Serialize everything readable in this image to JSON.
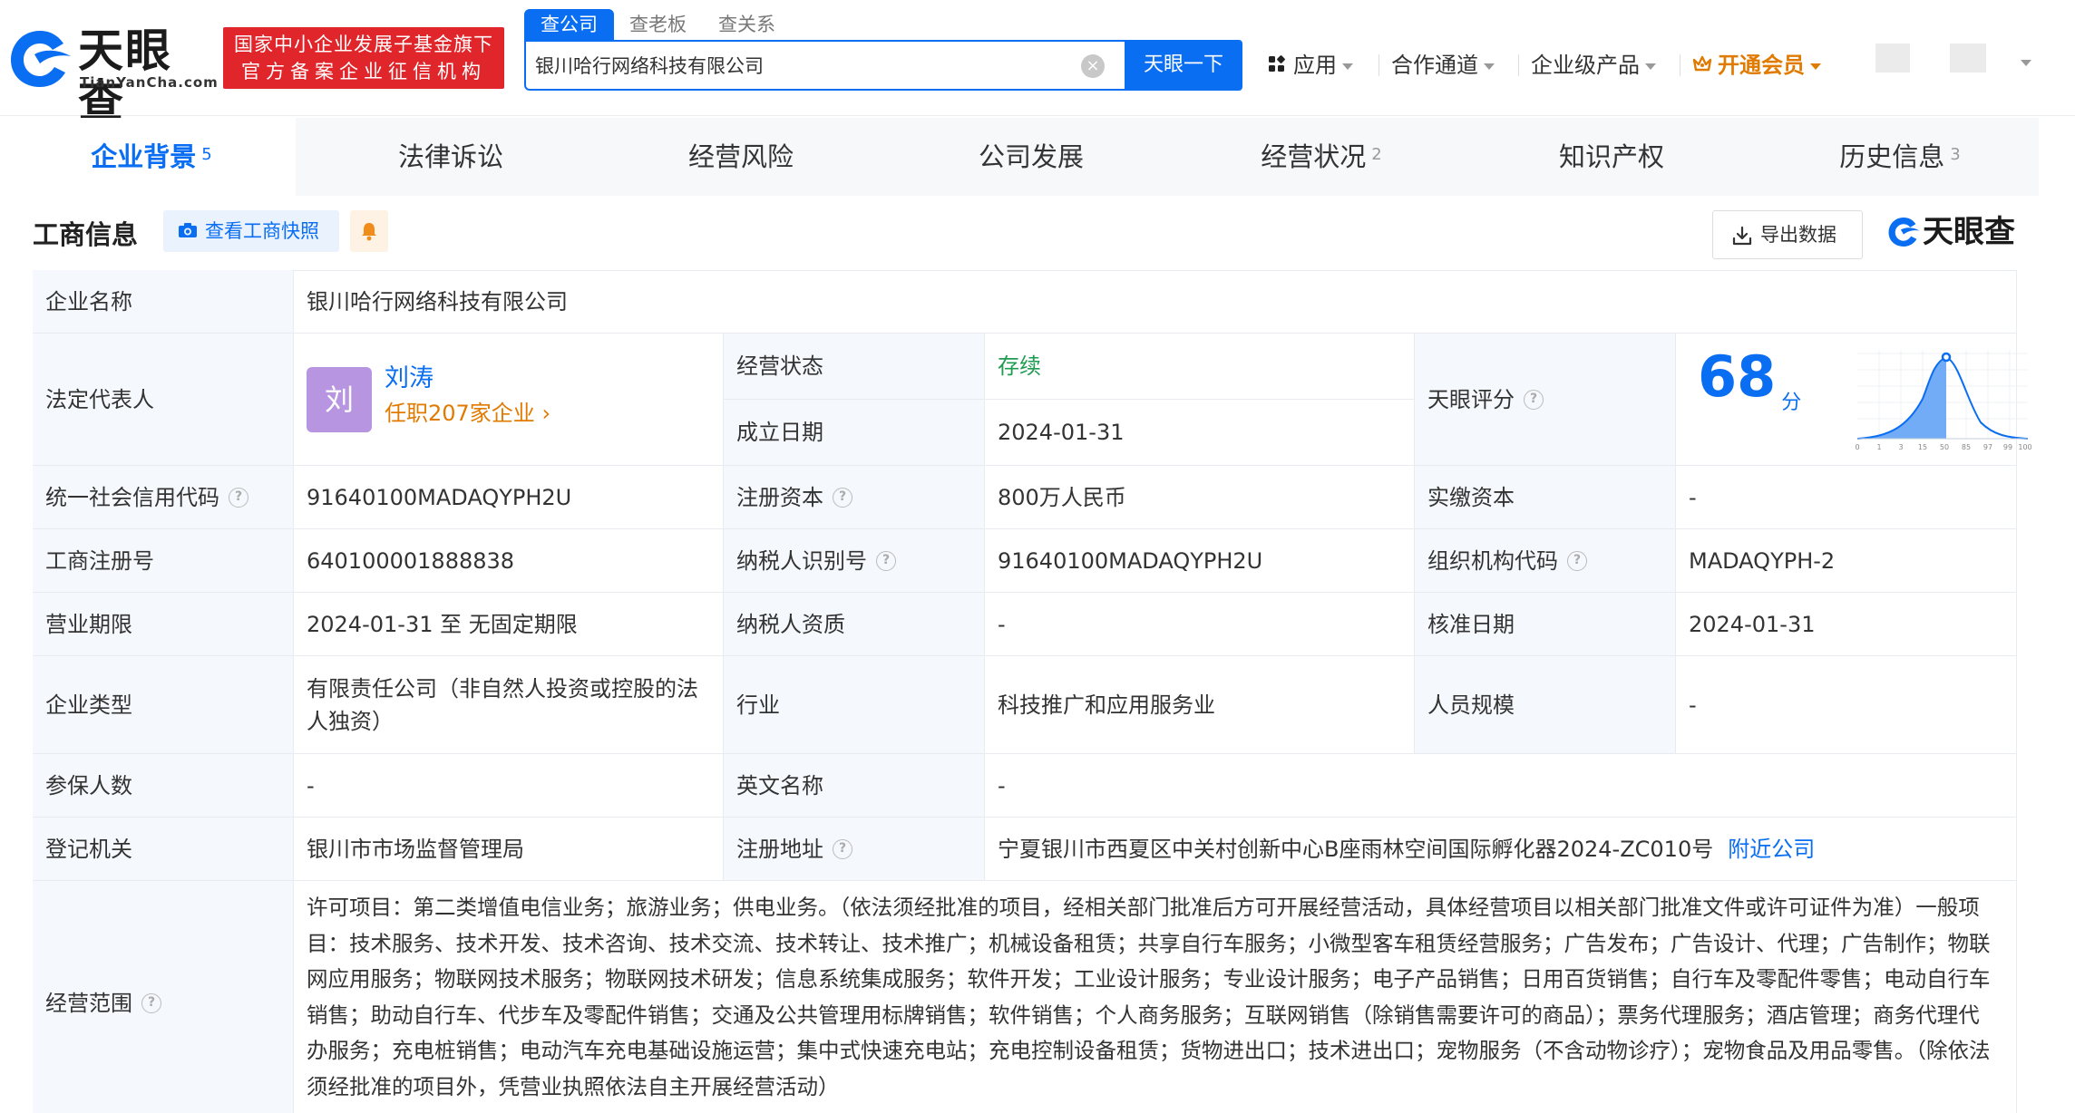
{
  "header": {
    "logo_text": "天眼查",
    "logo_sub": "TianYanCha.com",
    "gov_badge_line1": "国家中小企业发展子基金旗下",
    "gov_badge_line2": "官方备案企业征信机构",
    "search_tabs": [
      "查公司",
      "查老板",
      "查关系"
    ],
    "search_value": "银川哈行网络科技有限公司",
    "search_button": "天眼一下",
    "nav": {
      "apps": "应用",
      "partner": "合作通道",
      "enterprise": "企业级产品",
      "vip": "开通会员"
    }
  },
  "tabs": [
    {
      "label": "企业背景",
      "count": "5"
    },
    {
      "label": "法律诉讼",
      "count": ""
    },
    {
      "label": "经营风险",
      "count": ""
    },
    {
      "label": "公司发展",
      "count": ""
    },
    {
      "label": "经营状况",
      "count": "2"
    },
    {
      "label": "知识产权",
      "count": ""
    },
    {
      "label": "历史信息",
      "count": "3"
    }
  ],
  "section": {
    "title": "工商信息",
    "snapshot_button": "查看工商快照",
    "export_button": "导出数据",
    "brand": "天眼查"
  },
  "info": {
    "company_name_label": "企业名称",
    "company_name": "银川哈行网络科技有限公司",
    "legal_rep_label": "法定代表人",
    "legal_rep_avatar": "刘",
    "legal_rep_name": "刘涛",
    "legal_rep_positions": "任职207家企业",
    "status_label": "经营状态",
    "status": "存续",
    "founded_label": "成立日期",
    "founded": "2024-01-31",
    "score_label": "天眼评分",
    "score": "68",
    "score_unit": "分",
    "score_axis": [
      "0",
      "1",
      "3",
      "15",
      "50",
      "85",
      "97",
      "99",
      "100"
    ],
    "credit_code_label": "统一社会信用代码",
    "credit_code": "91640100MADAQYPH2U",
    "reg_capital_label": "注册资本",
    "reg_capital": "800万人民币",
    "paid_capital_label": "实缴资本",
    "paid_capital": "-",
    "reg_no_label": "工商注册号",
    "reg_no": "640100001888838",
    "taxpayer_id_label": "纳税人识别号",
    "taxpayer_id": "91640100MADAQYPH2U",
    "org_code_label": "组织机构代码",
    "org_code": "MADAQYPH-2",
    "term_label": "营业期限",
    "term": "2024-01-31 至 无固定期限",
    "taxpayer_qual_label": "纳税人资质",
    "taxpayer_qual": "-",
    "approval_label": "核准日期",
    "approval": "2024-01-31",
    "type_label": "企业类型",
    "type": "有限责任公司（非自然人投资或控股的法人独资）",
    "industry_label": "行业",
    "industry": "科技推广和应用服务业",
    "staff_label": "人员规模",
    "staff": "-",
    "insured_label": "参保人数",
    "insured": "-",
    "english_label": "英文名称",
    "english": "-",
    "authority_label": "登记机关",
    "authority": "银川市市场监督管理局",
    "address_label": "注册地址",
    "address": "宁夏银川市西夏区中关村创新中心B座雨林空间国际孵化器2024-ZC010号",
    "nearby_link": "附近公司",
    "scope_label": "经营范围",
    "scope": "许可项目：第二类增值电信业务；旅游业务；供电业务。（依法须经批准的项目，经相关部门批准后方可开展经营活动，具体经营项目以相关部门批准文件或许可证件为准）一般项目：技术服务、技术开发、技术咨询、技术交流、技术转让、技术推广；机械设备租赁；共享自行车服务；小微型客车租赁经营服务；广告发布；广告设计、代理；广告制作；物联网应用服务；物联网技术服务；物联网技术研发；信息系统集成服务；软件开发；工业设计服务；专业设计服务；电子产品销售；日用百货销售；自行车及零配件零售；电动自行车销售；助动自行车、代步车及零配件销售；交通及公共管理用标牌销售；软件销售；个人商务服务；互联网销售（除销售需要许可的商品）；票务代理服务；酒店管理；商务代理代办服务；充电桩销售；电动汽车充电基础设施运营；集中式快速充电站；充电控制设备租赁；货物进出口；技术进出口；宠物服务（不含动物诊疗）；宠物食品及用品零售。（除依法须经批准的项目外，凭营业执照依法自主开展经营活动）"
  }
}
